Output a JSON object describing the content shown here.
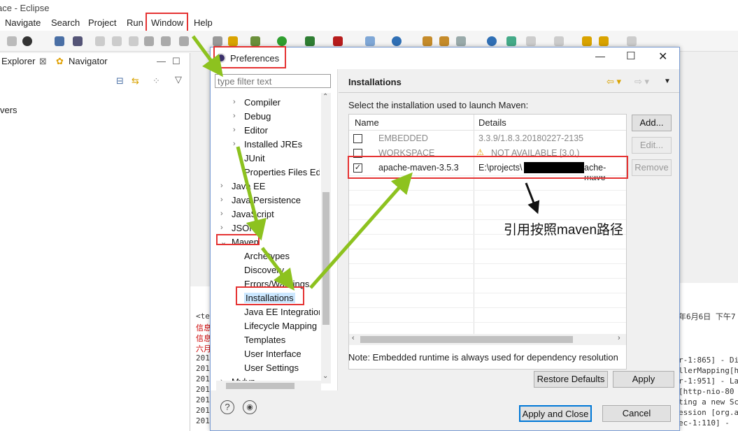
{
  "window": {
    "title": "ace - Eclipse"
  },
  "menubar": [
    "Navigate",
    "Search",
    "Project",
    "Run",
    "Window",
    "Help"
  ],
  "panel": {
    "tab_explorer": "Explorer",
    "tab_navigator": "Navigator",
    "tree_partial": "vers"
  },
  "console": {
    "left_lines": [
      "<te",
      "信息",
      "信息",
      "六月",
      "201",
      "201",
      "201",
      "201",
      "201",
      "201",
      "201"
    ],
    "right_lines": [
      "年6月6日 下午7",
      "r-1:865] - Di",
      "llerMapping[h",
      "r-1:951] - La",
      "[http-nio-80",
      "ting a new Sc",
      "ession [org.a",
      "ec-1:110] - "
    ]
  },
  "dialog": {
    "title": "Preferences",
    "filter_placeholder": "type filter text",
    "tree": [
      {
        "label": "Compiler",
        "indent": 2,
        "arrow": ">"
      },
      {
        "label": "Debug",
        "indent": 2,
        "arrow": ">"
      },
      {
        "label": "Editor",
        "indent": 2,
        "arrow": ">"
      },
      {
        "label": "Installed JREs",
        "indent": 2,
        "arrow": ">"
      },
      {
        "label": "JUnit",
        "indent": 2,
        "arrow": ""
      },
      {
        "label": "Properties Files Ed",
        "indent": 2,
        "arrow": ""
      },
      {
        "label": "Java EE",
        "indent": 1,
        "arrow": ">"
      },
      {
        "label": "Java Persistence",
        "indent": 1,
        "arrow": ">"
      },
      {
        "label": "JavaScript",
        "indent": 1,
        "arrow": ">"
      },
      {
        "label": "JSON",
        "indent": 1,
        "arrow": ">"
      },
      {
        "label": "Maven",
        "indent": 1,
        "arrow": "v"
      },
      {
        "label": "Archetypes",
        "indent": 2,
        "arrow": ""
      },
      {
        "label": "Discovery",
        "indent": 2,
        "arrow": ""
      },
      {
        "label": "Errors/Warnings",
        "indent": 2,
        "arrow": ""
      },
      {
        "label": "Installations",
        "indent": 2,
        "arrow": "",
        "selected": true
      },
      {
        "label": "Java EE Integration",
        "indent": 2,
        "arrow": ""
      },
      {
        "label": "Lifecycle Mapping",
        "indent": 2,
        "arrow": ""
      },
      {
        "label": "Templates",
        "indent": 2,
        "arrow": ""
      },
      {
        "label": "User Interface",
        "indent": 2,
        "arrow": ""
      },
      {
        "label": "User Settings",
        "indent": 2,
        "arrow": ""
      },
      {
        "label": "Mylyn",
        "indent": 1,
        "arrow": ">"
      }
    ],
    "page_title": "Installations",
    "description": "Select the installation used to launch Maven:",
    "columns": [
      "Name",
      "Details"
    ],
    "rows": [
      {
        "name": "EMBEDDED",
        "details": "3.3.9/1.8.3.20180227-2135",
        "checked": false,
        "dim": true
      },
      {
        "name": "WORKSPACE",
        "details": "NOT AVAILABLE [3.0,)",
        "checked": false,
        "dim": true,
        "warn": true
      },
      {
        "name": "apache-maven-3.5.3",
        "details_prefix": "E:\\projects\\",
        "details_suffix": "ache-mave",
        "checked": true,
        "dim": false
      }
    ],
    "buttons_side": [
      "Add...",
      "Edit...",
      "Remove"
    ],
    "note": "Note: Embedded runtime is always used for dependency resolution",
    "restore_defaults": "Restore Defaults",
    "apply": "Apply",
    "apply_close": "Apply and Close",
    "cancel": "Cancel"
  },
  "annotation": {
    "text": "引用按照maven路径"
  },
  "colors": {
    "highlight_red": "#e53333",
    "arrow_green": "#8dc21f",
    "selection_blue": "#cce8ff"
  }
}
